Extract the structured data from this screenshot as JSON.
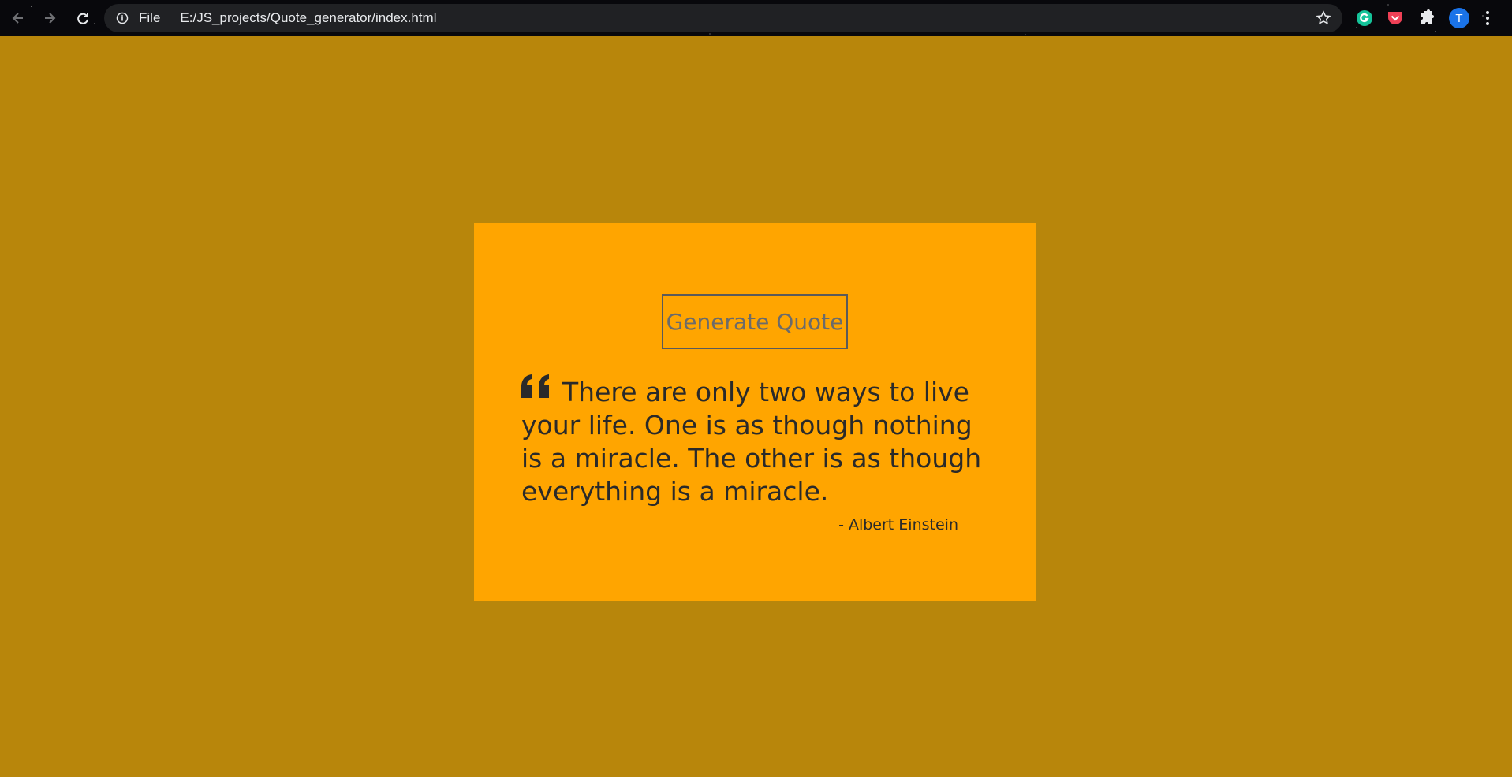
{
  "browser": {
    "site_info_label": "File",
    "url": "E:/JS_projects/Quote_generator/index.html",
    "profile_initial": "T",
    "icons": [
      "back-icon",
      "forward-icon",
      "reload-icon",
      "info-icon",
      "star-icon",
      "grammarly-icon",
      "pocket-icon",
      "extensions-icon",
      "menu-icon"
    ]
  },
  "page": {
    "background_color": "#b8860b",
    "card_color": "#ffa500",
    "generate_button_label": "Generate Quote",
    "quote_text": "There are only two ways to live your life. One is as though nothing is a miracle. The other is as though everything is a miracle.",
    "author": "- Albert Einstein"
  }
}
